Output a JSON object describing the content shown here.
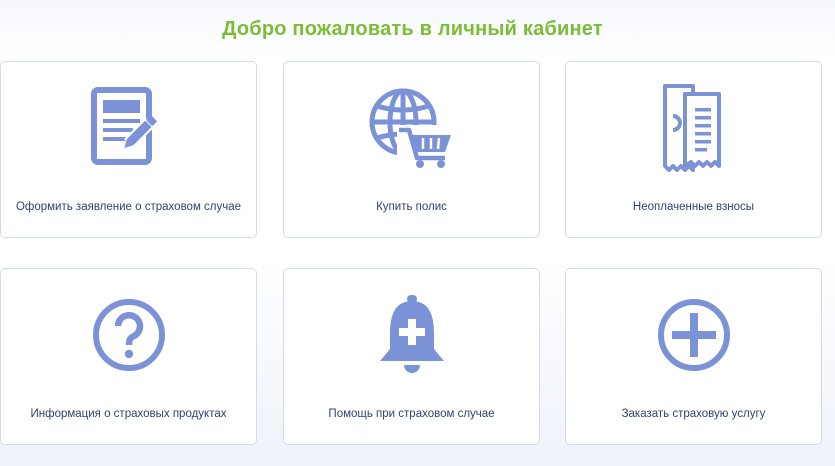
{
  "page": {
    "title": "Добро пожаловать в личный кабинет"
  },
  "cards": [
    {
      "label": "Оформить заявление о страховом случае",
      "icon": "document-pen-icon"
    },
    {
      "label": "Купить полис",
      "icon": "globe-cart-icon"
    },
    {
      "label": "Неоплаченные взносы",
      "icon": "receipt-icon"
    },
    {
      "label": "Информация о страховых продуктах",
      "icon": "question-icon"
    },
    {
      "label": "Помощь при страховом случае",
      "icon": "bell-plus-icon"
    },
    {
      "label": "Заказать страховую услугу",
      "icon": "plus-circle-icon"
    }
  ],
  "colors": {
    "title": "#7cbd35",
    "icon": "#7b93d6",
    "label": "#33426b",
    "card_border": "#d3dcea"
  }
}
